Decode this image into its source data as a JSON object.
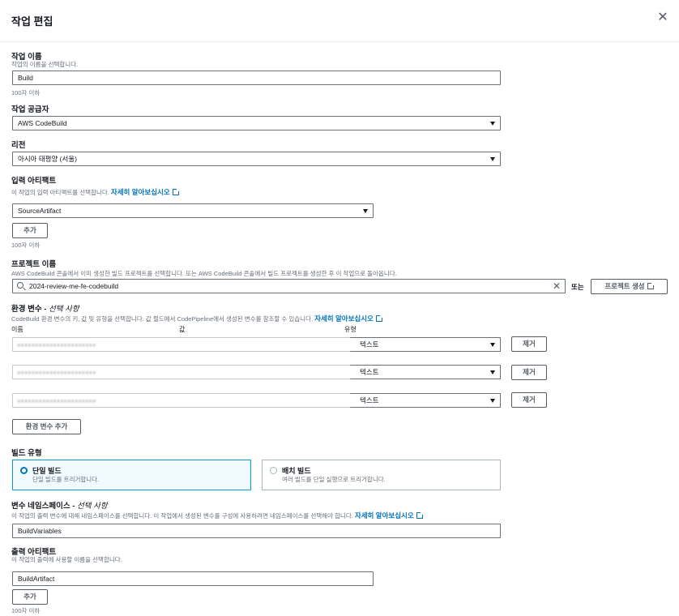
{
  "modal": {
    "title": "작업 편집",
    "close_label": "✕"
  },
  "action_name": {
    "label": "작업 이름",
    "desc": "작업의 이름을 선택합니다.",
    "value": "Build",
    "hint": "100자 이하"
  },
  "action_provider": {
    "label": "작업 공급자",
    "value": "AWS CodeBuild"
  },
  "region": {
    "label": "리전",
    "value": "아시아 태평양 (서울)"
  },
  "input_artifacts": {
    "label": "입력 아티팩트",
    "desc": "이 작업의 입력 아티팩트를 선택합니다.",
    "link": "자세히 알아보십시오",
    "value": "SourceArtifact",
    "add_label": "추가",
    "hint": "100자 이하"
  },
  "project_name": {
    "label": "프로젝트 이름",
    "desc": "AWS CodeBuild 콘솔에서 이미 생성한 빌드 프로젝트를 선택합니다. 또는 AWS CodeBuild 콘솔에서 빌드 프로젝트를 생성한 후 이 작업으로 돌아옵니다.",
    "value": "2024-review-me-fe-codebuild",
    "clear_label": "✕",
    "or_label": "또는",
    "create_label": "프로젝트 생성"
  },
  "env_vars": {
    "label": "환경 변수 - ",
    "label_optional": "선택 사항",
    "desc": "CodeBuild 환경 변수의 키, 값 및 유형을 선택합니다. 값 필드에서 CodePipeline에서 생성된 변수를 참조할 수 있습니다.",
    "link": "자세히 알아보십시오",
    "col_name": "이름",
    "col_value": "값",
    "col_type": "유형",
    "rows": [
      {
        "type": "텍스트",
        "remove_label": "제거"
      },
      {
        "type": "텍스트",
        "remove_label": "제거"
      },
      {
        "type": "텍스트",
        "remove_label": "제거"
      }
    ],
    "add_label": "환경 변수 추가"
  },
  "build_type": {
    "label": "빌드 유형",
    "options": [
      {
        "label": "단일 빌드",
        "desc": "단일 빌드를 트리거합니다.",
        "selected": true
      },
      {
        "label": "배치 빌드",
        "desc": "여러 빌드를 단일 실행으로 트리거합니다.",
        "selected": false
      }
    ]
  },
  "variable_namespace": {
    "label": "변수 네임스페이스 - ",
    "label_optional": "선택 사항",
    "desc": "이 작업의 출력 변수에 대해 네임스페이스를 선택합니다. 이 작업에서 생성된 변수를 구성에 사용하려면 네임스페이스를 선택해야 합니다.",
    "link": "자세히 알아보십시오",
    "value": "BuildVariables"
  },
  "output_artifacts": {
    "label": "출력 아티팩트",
    "desc": "이 작업의 출력에 사용할 이름을 선택합니다.",
    "value": "BuildArtifact",
    "add_label": "추가",
    "hint": "100자 이하"
  },
  "colors": {
    "accent": "#0073bb",
    "selected_border": "#00a1c9",
    "selected_bg": "#f1faff",
    "border": "#687078",
    "text": "#16191f",
    "muted": "#687078"
  }
}
